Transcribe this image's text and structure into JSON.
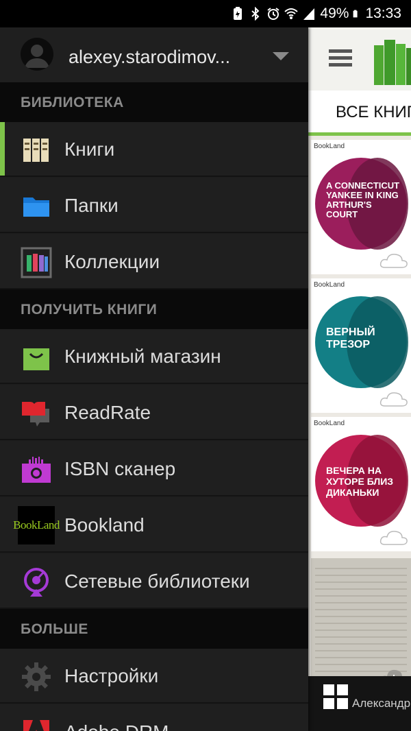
{
  "status_bar": {
    "battery": "49%",
    "time": "13:33"
  },
  "drawer": {
    "account": {
      "name": "alexey.starodimov..."
    },
    "sections": [
      {
        "label": "БИБЛИОТЕКА"
      },
      {
        "label": "ПОЛУЧИТЬ КНИГИ"
      },
      {
        "label": "БОЛЬШЕ"
      }
    ],
    "items": [
      {
        "label": "Книги",
        "icon": "books-icon"
      },
      {
        "label": "Папки",
        "icon": "folder-icon"
      },
      {
        "label": "Коллекции",
        "icon": "collections-icon"
      },
      {
        "label": "Книжный магазин",
        "icon": "shopping-bag-icon"
      },
      {
        "label": "ReadRate",
        "icon": "readrate-icon"
      },
      {
        "label": "ISBN сканер",
        "icon": "barcode-camera-icon"
      },
      {
        "label": "Bookland",
        "icon": "bookland-logo"
      },
      {
        "label": "Сетевые библиотеки",
        "icon": "network-library-icon"
      },
      {
        "label": "Настройки",
        "icon": "gear-icon"
      },
      {
        "label": "Adobe DRM",
        "icon": "adobe-icon"
      }
    ],
    "bookland_logo_text": "BookLand"
  },
  "content": {
    "tab_label": "ВСЕ КНИГИ",
    "books": [
      {
        "brand": "BookLand",
        "title": "A CONNECTICUT YANKEE IN KING ARTHUR'S COURT",
        "color": "#9b1e5c"
      },
      {
        "brand": "BookLand",
        "title": "ВЕРНЫЙ ТРЕЗОР",
        "color": "#137f86"
      },
      {
        "brand": "BookLand",
        "title": "ВЕЧЕРА НА ХУТОРЕ БЛИЗ ДИКАНЬКИ",
        "color": "#c21e52"
      }
    ],
    "bottom_text": "Александр Куприн"
  },
  "colors": {
    "accent": "#7ec34a",
    "drawer_bg": "#1f1f1f",
    "section_bg": "#0a0a0a"
  }
}
